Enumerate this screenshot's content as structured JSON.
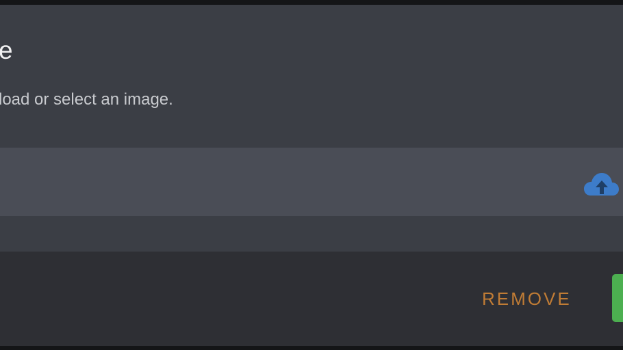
{
  "dialog": {
    "title": "e",
    "subtitle": "load or select an image."
  },
  "upload": {
    "icon": "cloud-upload-icon",
    "icon_color": "#3d7cc9"
  },
  "footer": {
    "remove_label": "REMOVE",
    "remove_color": "#c07c35",
    "confirm_color": "#4caf50"
  }
}
